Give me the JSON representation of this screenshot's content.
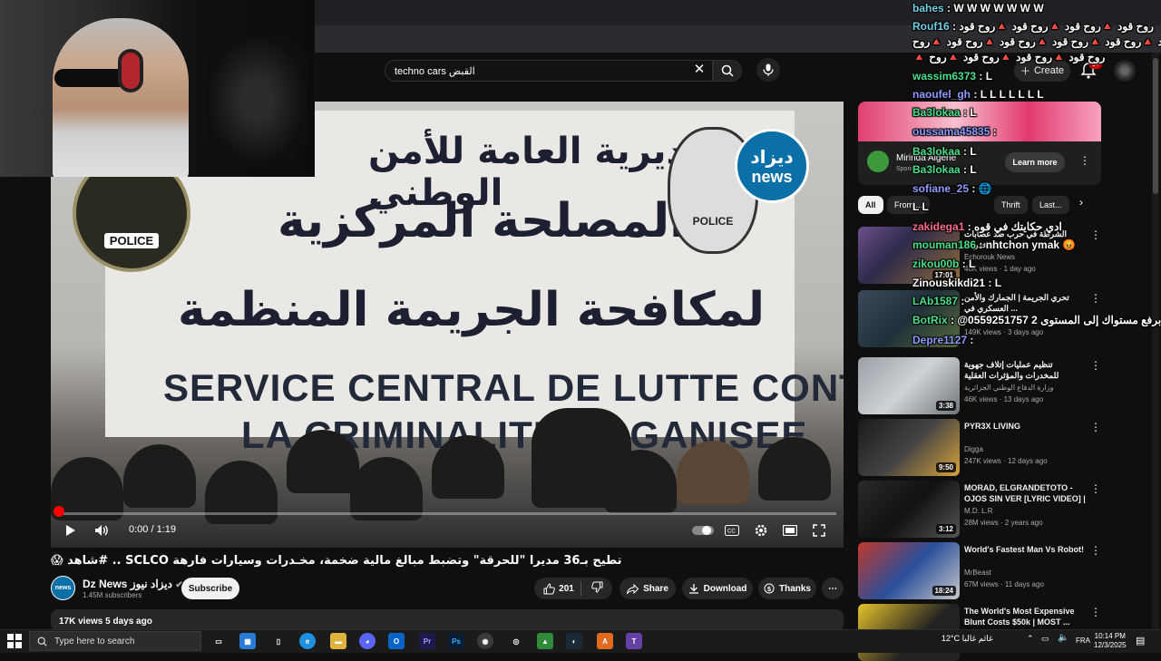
{
  "browser": {
    "tabs": [],
    "address": ""
  },
  "header": {
    "search_value": "techno cars القبض",
    "create_label": "Create",
    "notif_count": "9+"
  },
  "video": {
    "banner_ar_line1": "المديرية العامة للأمن الوطني",
    "banner_ar_line2": "المصلحة المركزية",
    "banner_ar_line3": "لمكافحة الجريمة المنظمة",
    "banner_fr_line1": "SERVICE CENTRAL DE LUTTE CONTRE",
    "banner_fr_line2": "LA CRIMINALITÉ ORGANISEE",
    "police_left": "POLICE",
    "police_right": "POLICE",
    "watermark_ar": "ديزاد",
    "watermark_en": "news",
    "time": "0:00 / 1:19",
    "progress": 0.0
  },
  "title": "تطيح بـ36 مديرا \"للحرقة\" وتضبط مبالغ مالية ضخمة، مخـدرات وسيارات فارهة SCLCO .. #شاهد 😱",
  "channel": {
    "name": "Dz News ديزاد نيوز",
    "subs": "1.45M subscribers",
    "avatar_text": "news",
    "subscribe_label": "Subscribe"
  },
  "actions": {
    "likes": "201",
    "share": "Share",
    "download": "Download",
    "thanks": "Thanks"
  },
  "description": {
    "views_date": "17K views  5 days ago"
  },
  "ad": {
    "name": "Mirinda Algérie",
    "sponsored": "Sponsored · ...om",
    "learn_more": "Learn more"
  },
  "chips": [
    "All",
    "From ...",
    "Thrift",
    "Last..."
  ],
  "recommendations": [
    {
      "title": "الشرطة في حرب ضد عصابات المخدرات",
      "channel": "Echorouk News",
      "meta": "40K views · 1 day ago",
      "duration": "17:01"
    },
    {
      "title": "تحري الجريمة | الجمارك والأمن العسكري في ...",
      "channel": "",
      "meta": "149K views · 3 days ago",
      "duration": ""
    },
    {
      "title": "تنظيم عمليات إتلاف جهوية للمخدرات والمؤثرات العقلية",
      "channel": "وزارة الدفاع الوطني الجزائرية",
      "meta": "46K views · 13 days ago",
      "duration": "3:38"
    },
    {
      "title": "PYR3X LIVING",
      "channel": "Digga",
      "meta": "247K views · 12 days ago",
      "duration": "9:50"
    },
    {
      "title": "MORAD, ELGRANDETOTO - OJOS SIN VER [LYRIC VIDEO] | ...",
      "channel": "M.D. L.R",
      "meta": "28M views · 2 years ago",
      "duration": "3:12"
    },
    {
      "title": "World's Fastest Man Vs Robot!",
      "channel": "MrBeast",
      "meta": "67M views · 11 days ago",
      "duration": "18:24"
    },
    {
      "title": "The World's Most Expensive Blunt Costs $50k | MOST ...",
      "channel": "",
      "meta": "",
      "duration": ""
    }
  ],
  "chat": [
    {
      "user": "bahes",
      "msg": "W W W W W W W",
      "color": "#6fd0e6"
    },
    {
      "user": "Rouf16",
      "msg": "روح قود 🔺روح قود 🔺روح قود 🔺روح قود",
      "color": "#6fd0e6"
    },
    {
      "user": "",
      "msg": "قود 🔺روح قود 🔺روح قود 🔺روح قود 🔺روح قود 🔺روح",
      "color": "#fff"
    },
    {
      "user": "",
      "msg": "🔺 روح قود 🔺روح قود 🔺روح قود 🔺روح",
      "color": "#fff"
    },
    {
      "user": "wassim6373",
      "msg": "L",
      "color": "#49e08a"
    },
    {
      "user": "naoufel_gh",
      "msg": "L L L L L L L",
      "color": "#8e9cff"
    },
    {
      "user": "Ba3lokaa",
      "msg": "L",
      "color": "#49e08a"
    },
    {
      "user": "oussama45835",
      "msg": "",
      "color": "#8e9cff"
    },
    {
      "user": "Ba3lokaa",
      "msg": "L",
      "color": "#49e08a"
    },
    {
      "user": "Ba3lokaa",
      "msg": "L",
      "color": "#49e08a"
    },
    {
      "user": "sofiane_25",
      "msg": "🌐",
      "color": "#8e9cff"
    },
    {
      "user": "",
      "msg": "L L",
      "color": "#fff"
    },
    {
      "user": "zakidega1",
      "msg": "ادي حكايتك في قوه",
      "color": "#ff6b8a"
    },
    {
      "user": "mouman186",
      "msg": "nhtchon ymak 😡",
      "color": "#49e08a"
    },
    {
      "user": "zikou00b",
      "msg": "L",
      "color": "#49e08a"
    },
    {
      "user": "Zinouskikdi21",
      "msg": "L",
      "color": "#fff"
    },
    {
      "user": "LAb1587",
      "msg": "",
      "color": "#49e08a"
    },
    {
      "user": "BotRix",
      "msg": "@0559251757 قمت برفع مستواك إلى المستوى 2",
      "color": "#49e08a"
    },
    {
      "user": "Depre1127",
      "msg": "",
      "color": "#8e9cff"
    }
  ],
  "taskbar": {
    "search_placeholder": "Type here to search",
    "temp": "12°C  غائم غالبا",
    "lang": "FRA",
    "time": "10:14 PM",
    "date": "12/3/2025"
  }
}
